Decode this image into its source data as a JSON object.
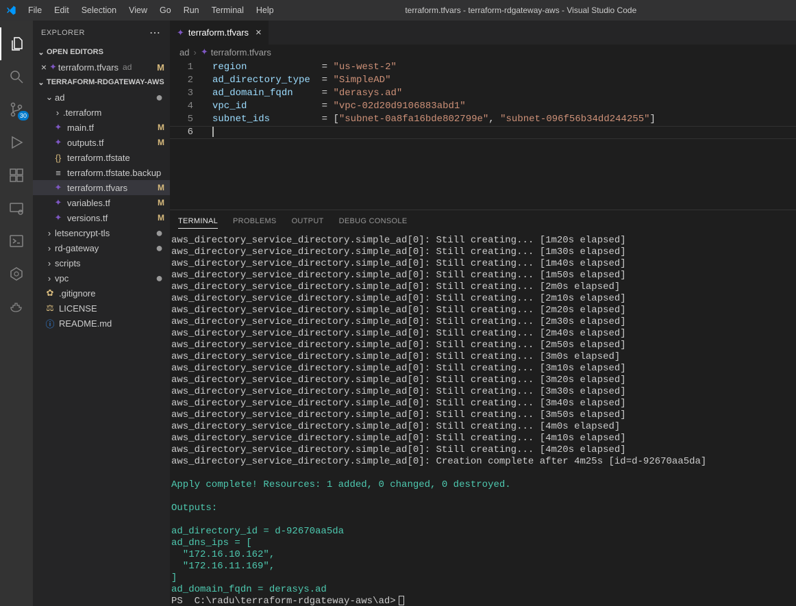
{
  "window_title": "terraform.tfvars - terraform-rdgateway-aws - Visual Studio Code",
  "menu": [
    "File",
    "Edit",
    "Selection",
    "View",
    "Go",
    "Run",
    "Terminal",
    "Help"
  ],
  "activity_badge": "30",
  "explorer": {
    "title": "EXPLORER",
    "open_editors_label": "OPEN EDITORS",
    "open_editor": {
      "name": "terraform.tfvars",
      "dir": "ad",
      "status": "M"
    },
    "folder_label": "TERRAFORM-RDGATEWAY-AWS",
    "tree": {
      "ad": "ad",
      "ad_dot": "●",
      "terraform_dir": ".terraform",
      "main_tf": "main.tf",
      "outputs_tf": "outputs.tf",
      "tfstate": "terraform.tfstate",
      "tfstate_backup": "terraform.tfstate.backup",
      "tfvars": "terraform.tfvars",
      "variables_tf": "variables.tf",
      "versions_tf": "versions.tf",
      "letsencrypt": "letsencrypt-tls",
      "rd_gateway": "rd-gateway",
      "scripts": "scripts",
      "vpc": "vpc",
      "gitignore": ".gitignore",
      "license": "LICENSE",
      "readme": "README.md",
      "status_M": "M",
      "dot": "●"
    }
  },
  "tab": {
    "name": "terraform.tfvars"
  },
  "breadcrumb": {
    "p1": "ad",
    "p2": "terraform.tfvars"
  },
  "code": {
    "l1": {
      "k": "region",
      "pad": "            ",
      "v": "\"us-west-2\""
    },
    "l2": {
      "k": "ad_directory_type",
      "pad": " ",
      "v": "\"SimpleAD\""
    },
    "l3": {
      "k": "ad_domain_fqdn",
      "pad": "    ",
      "v": "\"derasys.ad\""
    },
    "l4": {
      "k": "vpc_id",
      "pad": "            ",
      "v": "\"vpc-02d20d9106883abd1\""
    },
    "l5": {
      "k": "subnet_ids",
      "pad": "        ",
      "v1": "\"subnet-0a8fa16bde802799e\"",
      "v2": "\"subnet-096f56b34dd244255\""
    }
  },
  "panel_tabs": {
    "terminal": "TERMINAL",
    "problems": "PROBLEMS",
    "output": "OUTPUT",
    "debug": "DEBUG CONSOLE"
  },
  "terminal": {
    "creating_prefix": "aws_directory_service_directory.simple_ad[0]: Still creating... ",
    "elapsed": [
      "[1m20s elapsed]",
      "[1m30s elapsed]",
      "[1m40s elapsed]",
      "[1m50s elapsed]",
      "[2m0s elapsed]",
      "[2m10s elapsed]",
      "[2m20s elapsed]",
      "[2m30s elapsed]",
      "[2m40s elapsed]",
      "[2m50s elapsed]",
      "[3m0s elapsed]",
      "[3m10s elapsed]",
      "[3m20s elapsed]",
      "[3m30s elapsed]",
      "[3m40s elapsed]",
      "[3m50s elapsed]",
      "[4m0s elapsed]",
      "[4m10s elapsed]",
      "[4m20s elapsed]"
    ],
    "complete": "aws_directory_service_directory.simple_ad[0]: Creation complete after 4m25s [id=d-92670aa5da]",
    "apply": "Apply complete! Resources: 1 added, 0 changed, 0 destroyed.",
    "outputs_label": "Outputs:",
    "out1": "ad_directory_id = d-92670aa5da",
    "out2": "ad_dns_ips = [",
    "out3": "  \"172.16.10.162\",",
    "out4": "  \"172.16.11.169\",",
    "out5": "]",
    "out6": "ad_domain_fqdn = derasys.ad",
    "prompt": "PS  C:\\radu\\terraform-rdgateway-aws\\ad>"
  }
}
